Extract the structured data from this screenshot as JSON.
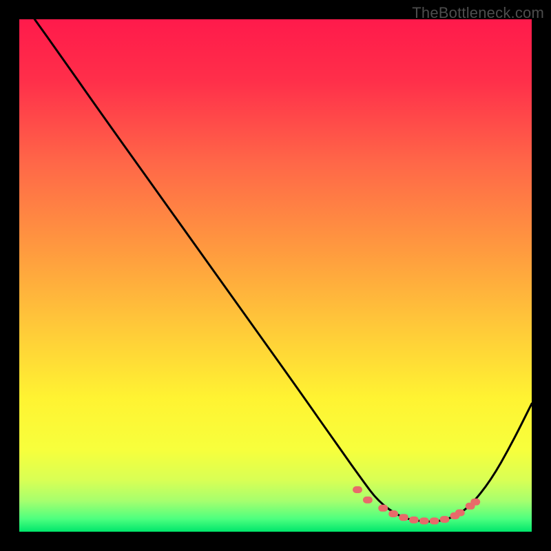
{
  "watermark": "TheBottleneck.com",
  "chart_data": {
    "type": "line",
    "title": "",
    "xlabel": "",
    "ylabel": "",
    "xlim": [
      0,
      100
    ],
    "ylim": [
      0,
      100
    ],
    "grid": false,
    "legend": false,
    "series": [
      {
        "name": "bottleneck-curve",
        "x": [
          3,
          8,
          15,
          25,
          35,
          45,
          55,
          62,
          67,
          70,
          74,
          78,
          82,
          85,
          88,
          92,
          96,
          100
        ],
        "y": [
          100,
          93,
          83,
          69,
          55,
          41,
          27,
          17,
          10,
          6,
          3,
          2,
          2,
          3,
          5,
          10,
          17,
          25
        ]
      }
    ],
    "optimal_markers": {
      "x": [
        66,
        68,
        71,
        73,
        75,
        77,
        79,
        81,
        83,
        85,
        86,
        88,
        89
      ],
      "y": [
        8.2,
        6.2,
        4.6,
        3.5,
        2.8,
        2.3,
        2.1,
        2.1,
        2.4,
        3.1,
        3.7,
        5.0,
        5.8
      ]
    },
    "gradient_stops": [
      {
        "offset": 0.0,
        "color": "#ff1a4b"
      },
      {
        "offset": 0.12,
        "color": "#ff2f4a"
      },
      {
        "offset": 0.28,
        "color": "#ff6748"
      },
      {
        "offset": 0.45,
        "color": "#ff9a3f"
      },
      {
        "offset": 0.6,
        "color": "#ffc939"
      },
      {
        "offset": 0.74,
        "color": "#fff332"
      },
      {
        "offset": 0.84,
        "color": "#f7ff3c"
      },
      {
        "offset": 0.9,
        "color": "#d8ff55"
      },
      {
        "offset": 0.94,
        "color": "#a6ff6e"
      },
      {
        "offset": 0.975,
        "color": "#4dff7f"
      },
      {
        "offset": 1.0,
        "color": "#00e66b"
      }
    ],
    "marker_color": "#e86a6a",
    "curve_color": "#000000"
  }
}
